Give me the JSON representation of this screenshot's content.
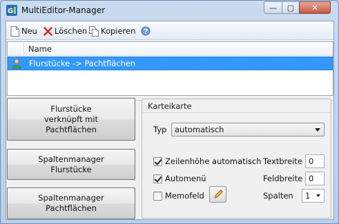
{
  "window": {
    "title": "MultiEditor-Manager",
    "minimize_glyph": "—",
    "maximize_glyph": "▢",
    "close_glyph": "✕"
  },
  "toolbar": {
    "new_label": "Neu",
    "delete_label": "Löschen",
    "copy_label": "Kopieren"
  },
  "grid": {
    "column_name": "Name",
    "rows": [
      {
        "name": "Flurstücke -> Pachtflächen",
        "selected": true
      }
    ]
  },
  "buttons": {
    "btn1_line1": "Flurstücke",
    "btn1_line2": "verknüpft mit",
    "btn1_line3": "Pachtflächen",
    "btn2_line1": "Spaltenmanager",
    "btn2_line2": "Flurstücke",
    "btn3_line1": "Spaltenmanager",
    "btn3_line2": "Pachtflächen"
  },
  "karteikarte": {
    "title": "Karteikarte",
    "typ_label": "Typ",
    "typ_value": "automatisch",
    "zeilenhoehe_label": "Zeilenhöhe automatisch",
    "zeilenhoehe_checked": true,
    "automenu_label": "Automenü",
    "automenu_checked": true,
    "memofeld_label": "Memofeld",
    "memofeld_checked": false,
    "textbreite_label": "Textbreite",
    "textbreite_value": "0",
    "feldbreite_label": "Feldbreite",
    "feldbreite_value": "0",
    "spalten_label": "Spalten",
    "spalten_value": "1"
  },
  "colors": {
    "selection": "#3399ff",
    "close_button": "#c55a43",
    "delete_icon": "#d0261d"
  }
}
